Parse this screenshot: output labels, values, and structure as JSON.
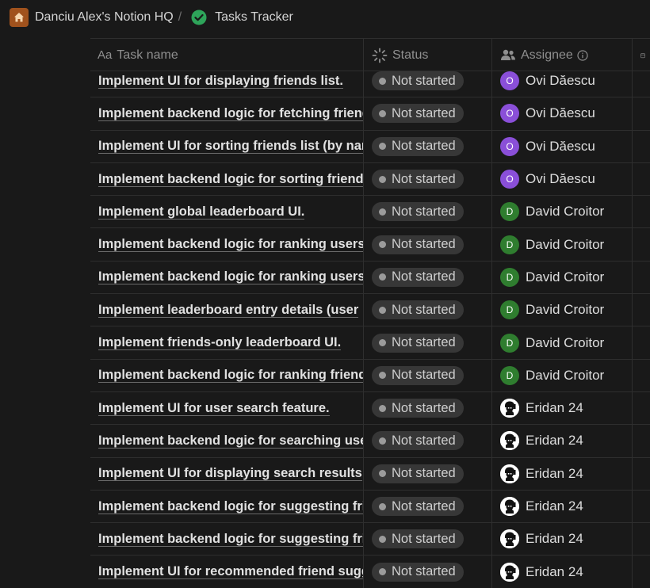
{
  "breadcrumb": {
    "workspace": "Danciu Alex's Notion HQ",
    "separator": "/",
    "page": "Tasks Tracker"
  },
  "table": {
    "columns": {
      "task": "Task name",
      "task_prefix": "Aa",
      "status": "Status",
      "assignee": "Assignee"
    },
    "rows": [
      {
        "task": "Implement UI for displaying friends list.",
        "status": "Not started",
        "assignee": "Ovi Dăescu",
        "avatar_initial": "O",
        "avatar_color": "#8a4fd8"
      },
      {
        "task": "Implement backend logic for fetching friends",
        "status": "Not started",
        "assignee": "Ovi Dăescu",
        "avatar_initial": "O",
        "avatar_color": "#8a4fd8"
      },
      {
        "task": "Implement UI for sorting friends list (by name",
        "status": "Not started",
        "assignee": "Ovi Dăescu",
        "avatar_initial": "O",
        "avatar_color": "#8a4fd8"
      },
      {
        "task": "Implement backend logic for sorting friends",
        "status": "Not started",
        "assignee": "Ovi Dăescu",
        "avatar_initial": "O",
        "avatar_color": "#8a4fd8"
      },
      {
        "task": "Implement global leaderboard UI.",
        "status": "Not started",
        "assignee": "David Croitor",
        "avatar_initial": "D",
        "avatar_color": "#2f7d2f"
      },
      {
        "task": "Implement backend logic for ranking users",
        "status": "Not started",
        "assignee": "David Croitor",
        "avatar_initial": "D",
        "avatar_color": "#2f7d2f"
      },
      {
        "task": "Implement backend logic for ranking users",
        "status": "Not started",
        "assignee": "David Croitor",
        "avatar_initial": "D",
        "avatar_color": "#2f7d2f"
      },
      {
        "task": "Implement leaderboard entry details (user",
        "status": "Not started",
        "assignee": "David Croitor",
        "avatar_initial": "D",
        "avatar_color": "#2f7d2f"
      },
      {
        "task": "Implement friends-only leaderboard UI.",
        "status": "Not started",
        "assignee": "David Croitor",
        "avatar_initial": "D",
        "avatar_color": "#2f7d2f"
      },
      {
        "task": "Implement backend logic for ranking friends",
        "status": "Not started",
        "assignee": "David Croitor",
        "avatar_initial": "D",
        "avatar_color": "#2f7d2f"
      },
      {
        "task": "Implement UI for user search feature.",
        "status": "Not started",
        "assignee": "Eridan 24",
        "avatar_initial": "",
        "avatar_color": ""
      },
      {
        "task": "Implement backend logic for searching users",
        "status": "Not started",
        "assignee": "Eridan 24",
        "avatar_initial": "",
        "avatar_color": ""
      },
      {
        "task": "Implement UI for displaying search results",
        "status": "Not started",
        "assignee": "Eridan 24",
        "avatar_initial": "",
        "avatar_color": ""
      },
      {
        "task": "Implement backend logic for suggesting friends",
        "status": "Not started",
        "assignee": "Eridan 24",
        "avatar_initial": "",
        "avatar_color": ""
      },
      {
        "task": "Implement backend logic for suggesting friends",
        "status": "Not started",
        "assignee": "Eridan 24",
        "avatar_initial": "",
        "avatar_color": ""
      },
      {
        "task": "Implement UI for recommended friend suggestions",
        "status": "Not started",
        "assignee": "Eridan 24",
        "avatar_initial": "",
        "avatar_color": ""
      }
    ]
  },
  "colors": {
    "background": "#191919",
    "workspace_icon": "#a0521d",
    "page_icon": "#2ea45a",
    "status_pill": "#373737"
  },
  "icons": {
    "workspace": "home-icon",
    "page": "check-circle-icon",
    "status": "loading-spinner-icon",
    "assignee": "people-icon",
    "info": "info-icon",
    "extra": "calendar-icon"
  }
}
